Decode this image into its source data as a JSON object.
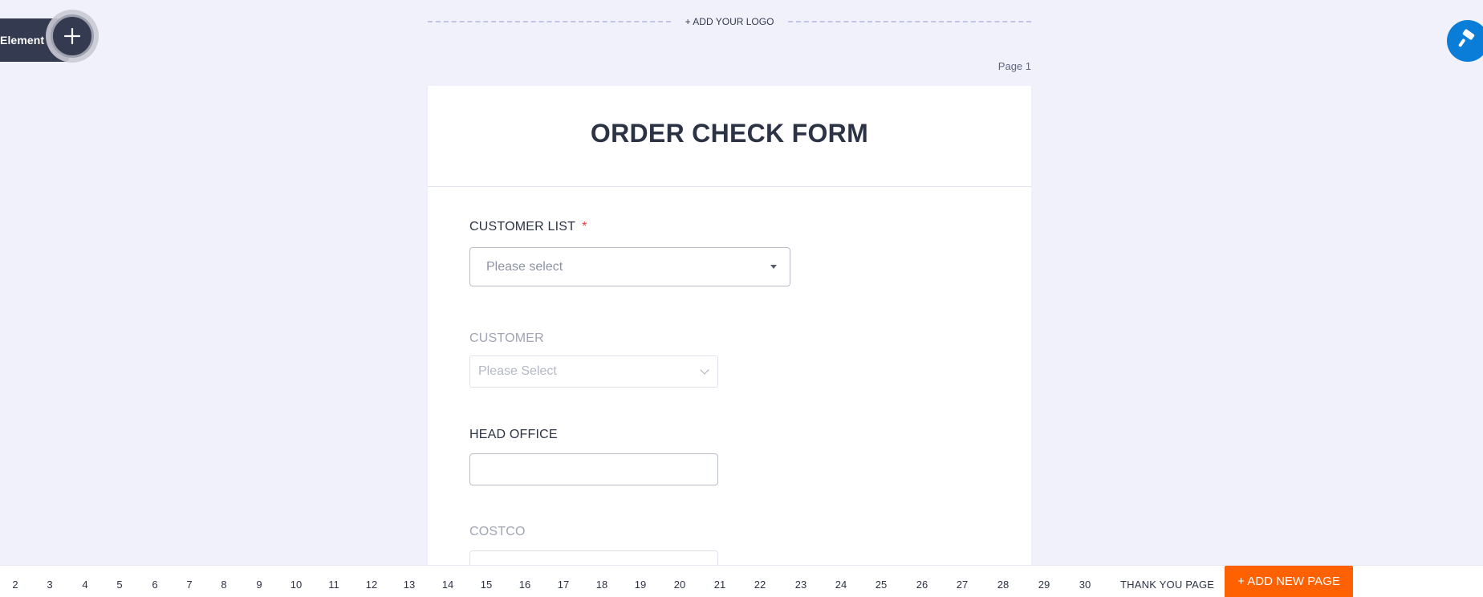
{
  "toolbar": {
    "add_element_label": "Element",
    "add_logo_label": "+ ADD YOUR LOGO",
    "page_indicator": "Page 1"
  },
  "form": {
    "title": "ORDER CHECK FORM",
    "fields": [
      {
        "label": "CUSTOMER LIST",
        "required_marker": "*",
        "type": "select",
        "placeholder": "Please select"
      },
      {
        "label": "CUSTOMER",
        "type": "select",
        "placeholder": "Please Select",
        "disabled": true
      },
      {
        "label": "HEAD OFFICE",
        "type": "text",
        "value": ""
      },
      {
        "label": "COSTCO",
        "type": "text",
        "value": "",
        "disabled": true
      }
    ]
  },
  "pages": {
    "tabs": [
      "2",
      "3",
      "4",
      "5",
      "6",
      "7",
      "8",
      "9",
      "10",
      "11",
      "12",
      "13",
      "14",
      "15",
      "16",
      "17",
      "18",
      "19",
      "20",
      "21",
      "22",
      "23",
      "24",
      "25",
      "26",
      "27",
      "28",
      "29",
      "30"
    ],
    "thank_you_label": "THANK YOU PAGE",
    "add_new_page_label": "+ ADD NEW PAGE"
  },
  "icons": {
    "add": "plus-icon",
    "designer": "paint-roller-icon"
  },
  "colors": {
    "background": "#f1f1fb",
    "accent_orange": "#ff6100",
    "designer_blue": "#0a7dd8",
    "required_red": "#f23a3c",
    "dark_navy": "#343a4f"
  }
}
